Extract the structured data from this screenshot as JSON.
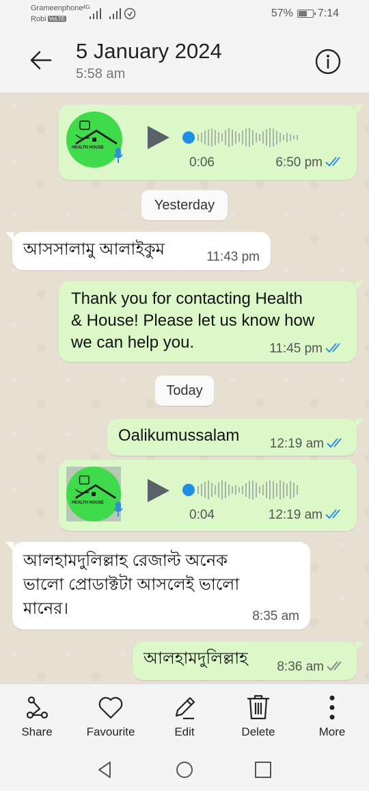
{
  "status_bar": {
    "carrier1": "Grameenphone",
    "carrier2": "Robi",
    "carrier2_badge": "VoLTE",
    "network": "4G",
    "battery": "57%",
    "time": "7:14"
  },
  "header": {
    "title": "5 January 2024",
    "subtitle": "5:58 am"
  },
  "messages": [
    {
      "type": "voice",
      "dir": "out",
      "avatar_text": "HEALTH HOUSE",
      "duration": "0:06",
      "time": "6:50 pm",
      "status": "read"
    },
    {
      "type": "date",
      "text": "Yesterday"
    },
    {
      "type": "text",
      "dir": "in",
      "text": "আসসালামু আলাইকুম",
      "time": "11:43 pm"
    },
    {
      "type": "text",
      "dir": "out",
      "lines": [
        "Thank you for contacting Health",
        "& House! Please let us know how",
        "we can help you."
      ],
      "time": "11:45 pm",
      "status": "read"
    },
    {
      "type": "date",
      "text": "Today"
    },
    {
      "type": "text",
      "dir": "out",
      "text": "Oalikumussalam",
      "time": "12:19 am",
      "status": "read"
    },
    {
      "type": "voice",
      "dir": "out",
      "avatar_text": "HEALTH HOUSE",
      "duration": "0:04",
      "time": "12:19 am",
      "status": "read"
    },
    {
      "type": "text",
      "dir": "in",
      "lines": [
        "আলহামদুলিল্লাহ রেজাল্ট অনেক",
        "ভালো প্রোডাক্টটা আসলেই ভালো",
        "মানের।"
      ],
      "time": "8:35 am"
    },
    {
      "type": "text",
      "dir": "out",
      "text": "আলহামদুলিল্লাহ",
      "time": "8:36 am",
      "status": "delivered"
    }
  ],
  "actions": [
    {
      "label": "Share",
      "icon": "share-icon"
    },
    {
      "label": "Favourite",
      "icon": "heart-icon"
    },
    {
      "label": "Edit",
      "icon": "pencil-icon"
    },
    {
      "label": "Delete",
      "icon": "trash-icon"
    },
    {
      "label": "More",
      "icon": "more-vertical-icon"
    }
  ],
  "colors": {
    "outgoing_bubble": "#ddf8c8",
    "incoming_bubble": "#ffffff",
    "chat_background": "#e8dfd3",
    "read_ticks": "#2f8fd8",
    "voice_dot": "#1f8fe6",
    "avatar_green": "#3fdb4b"
  }
}
